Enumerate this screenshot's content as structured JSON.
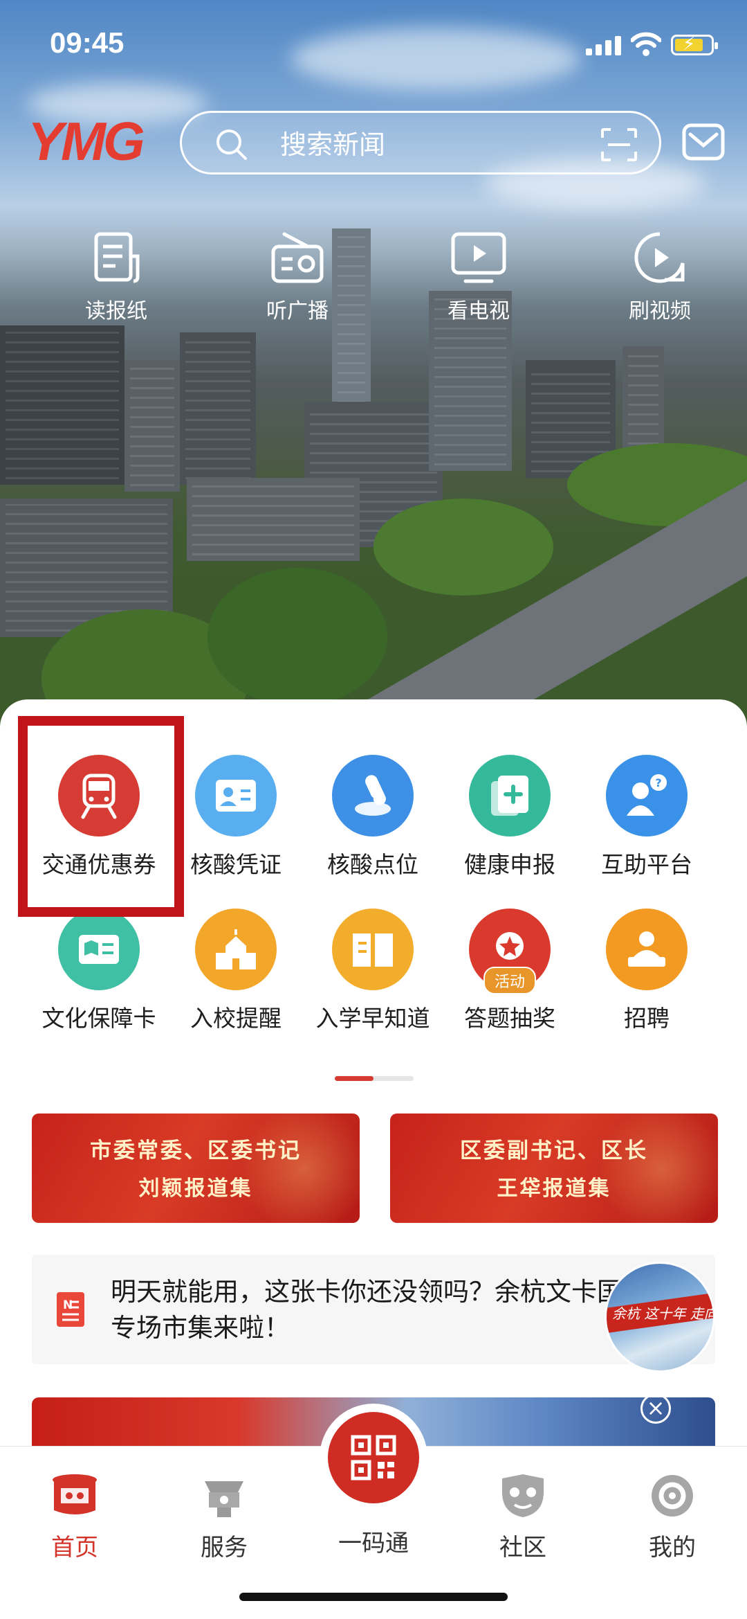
{
  "status_bar": {
    "time": "09:45"
  },
  "header": {
    "logo": "YMG",
    "search_placeholder": "搜索新闻"
  },
  "quick_links": [
    {
      "label": "读报纸",
      "icon": "newspaper-icon"
    },
    {
      "label": "听广播",
      "icon": "radio-icon"
    },
    {
      "label": "看电视",
      "icon": "tv-icon"
    },
    {
      "label": "刷视频",
      "icon": "video-icon"
    }
  ],
  "services": [
    {
      "label": "交通优惠券",
      "icon": "train-icon",
      "color": "#d63c33"
    },
    {
      "label": "核酸凭证",
      "icon": "id-card-icon",
      "color": "#59aef0"
    },
    {
      "label": "核酸点位",
      "icon": "test-tube-icon",
      "color": "#3e90e6"
    },
    {
      "label": "健康申报",
      "icon": "health-doc-icon",
      "color": "#35b99b"
    },
    {
      "label": "互助平台",
      "icon": "help-person-icon",
      "color": "#3a92e8"
    },
    {
      "label": "文化保障卡",
      "icon": "culture-card-icon",
      "color": "#3fbfa3"
    },
    {
      "label": "入校提醒",
      "icon": "school-icon",
      "color": "#f3a72a"
    },
    {
      "label": "入学早知道",
      "icon": "book-icon",
      "color": "#f3ad2c"
    },
    {
      "label": "答题抽奖",
      "icon": "medal-icon",
      "color": "#da3a2e",
      "tag": "活动"
    },
    {
      "label": "招聘",
      "icon": "recruit-icon",
      "color": "#f39a22"
    }
  ],
  "banners": [
    {
      "line1": "市委常委、区委书记",
      "line2": "刘颖报道集"
    },
    {
      "line1": "区委副书记、区长",
      "line2": "王牮报道集"
    }
  ],
  "news": {
    "text": "明天就能用，这张卡你还没领吗？余杭文卡国庆专场市集来啦！"
  },
  "float_ad": {
    "text": "余杭 这十年 走向"
  },
  "tabs": [
    {
      "label": "首页",
      "active": true
    },
    {
      "label": "服务"
    },
    {
      "label": "一码通"
    },
    {
      "label": "社区"
    },
    {
      "label": "我的"
    }
  ],
  "colors": {
    "accent": "#d4332a",
    "highlight": "#c0141a"
  }
}
